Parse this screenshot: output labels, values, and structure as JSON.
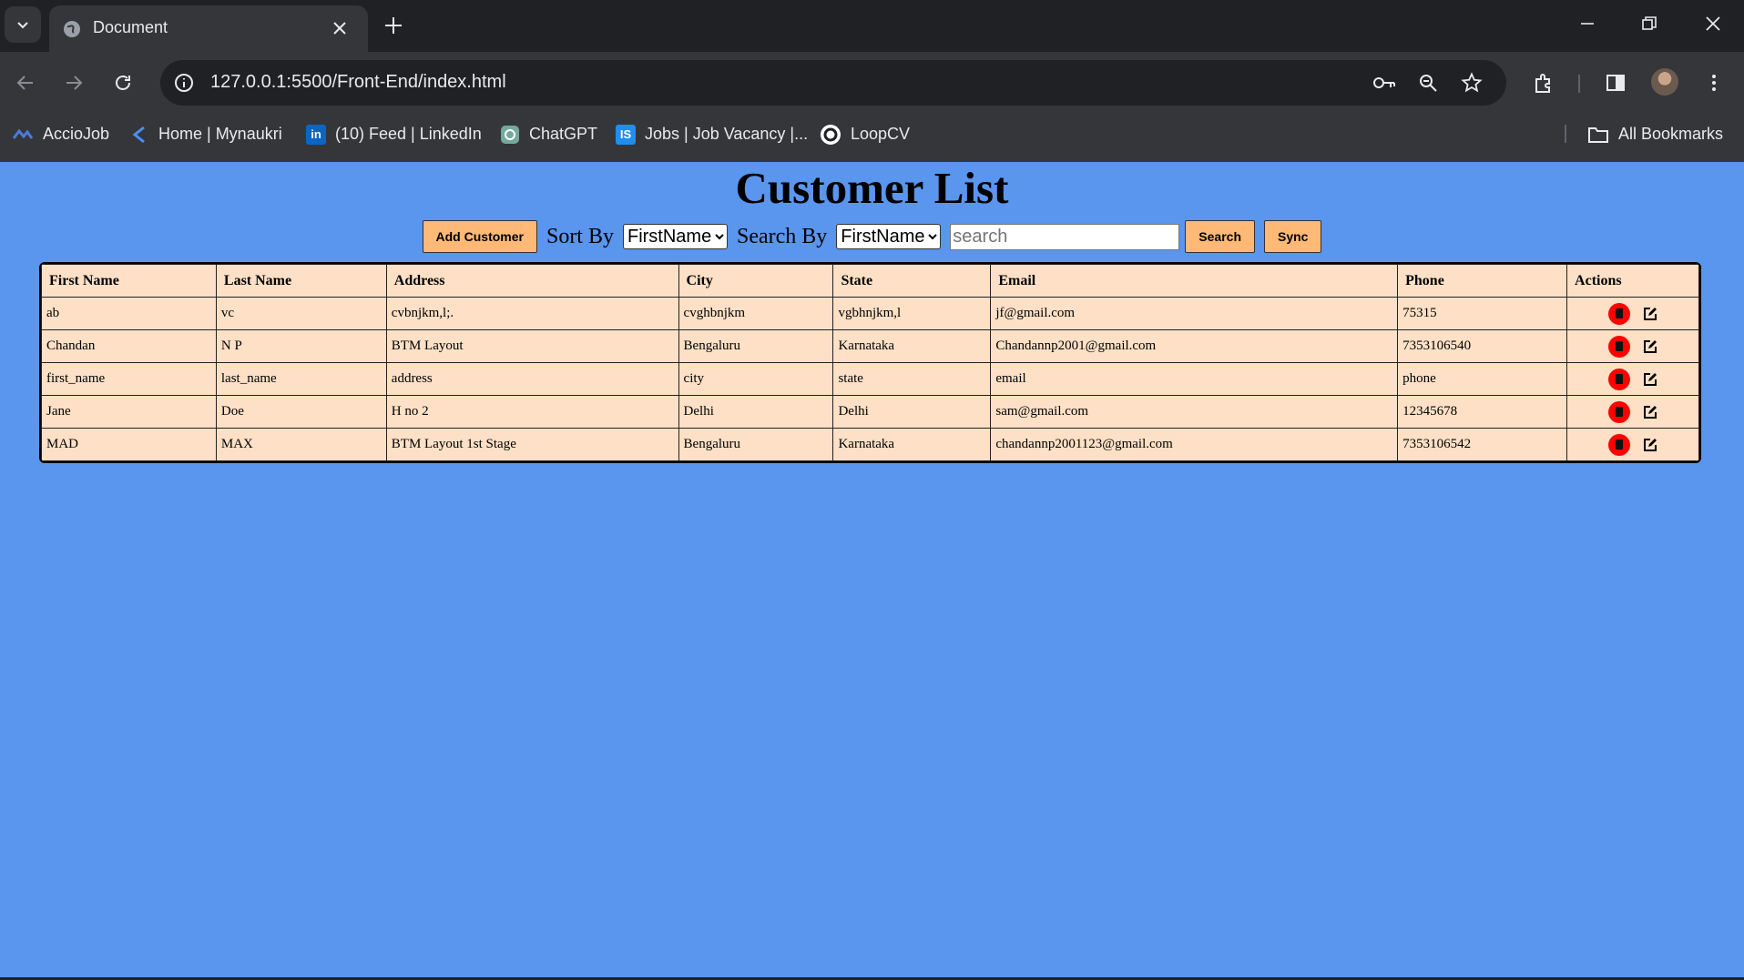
{
  "browser": {
    "tab_title": "Document",
    "url": "127.0.0.1:5500/Front-End/index.html",
    "bookmarks": [
      {
        "label": "AccioJob",
        "icon": "acciojob-icon"
      },
      {
        "label": "Home | Mynaukri",
        "icon": "mynaukri-icon"
      },
      {
        "label": "(10) Feed | LinkedIn",
        "icon": "linkedin-icon"
      },
      {
        "label": "ChatGPT",
        "icon": "chatgpt-icon"
      },
      {
        "label": "Jobs | Job Vacancy |...",
        "icon": "jobs-icon"
      },
      {
        "label": "LoopCV",
        "icon": "loopcv-icon"
      }
    ],
    "all_bookmarks": "All Bookmarks"
  },
  "page": {
    "title": "Customer List",
    "add_button": "Add Customer",
    "sort_label": "Sort By",
    "sort_value": "FirstName",
    "search_by_label": "Search By",
    "search_by_value": "FirstName",
    "search_placeholder": "search",
    "search_button": "Search",
    "sync_button": "Sync"
  },
  "table": {
    "headers": [
      "First Name",
      "Last Name",
      "Address",
      "City",
      "State",
      "Email",
      "Phone",
      "Actions"
    ],
    "rows": [
      [
        "ab",
        "vc",
        "cvbnjkm,l;.",
        "cvghbnjkm",
        "vgbhnjkm,l",
        "jf@gmail.com",
        "75315"
      ],
      [
        "Chandan",
        "N P",
        "BTM Layout",
        "Bengaluru",
        "Karnataka",
        "Chandannp2001@gmail.com",
        "7353106540"
      ],
      [
        "first_name",
        "last_name",
        "address",
        "city",
        "state",
        "email",
        "phone"
      ],
      [
        "Jane",
        "Doe",
        "H no 2",
        "Delhi",
        "Delhi",
        "sam@gmail.com",
        "12345678"
      ],
      [
        "MAD",
        "MAX",
        "BTM Layout 1st Stage",
        "Bengaluru",
        "Karnataka",
        "chandannp2001123@gmail.com",
        "7353106542"
      ]
    ]
  },
  "colors": {
    "page_bg": "#5a95ee",
    "table_bg": "#fde0c6",
    "button_bg": "#fdb975",
    "delete_red": "#ff0000"
  }
}
